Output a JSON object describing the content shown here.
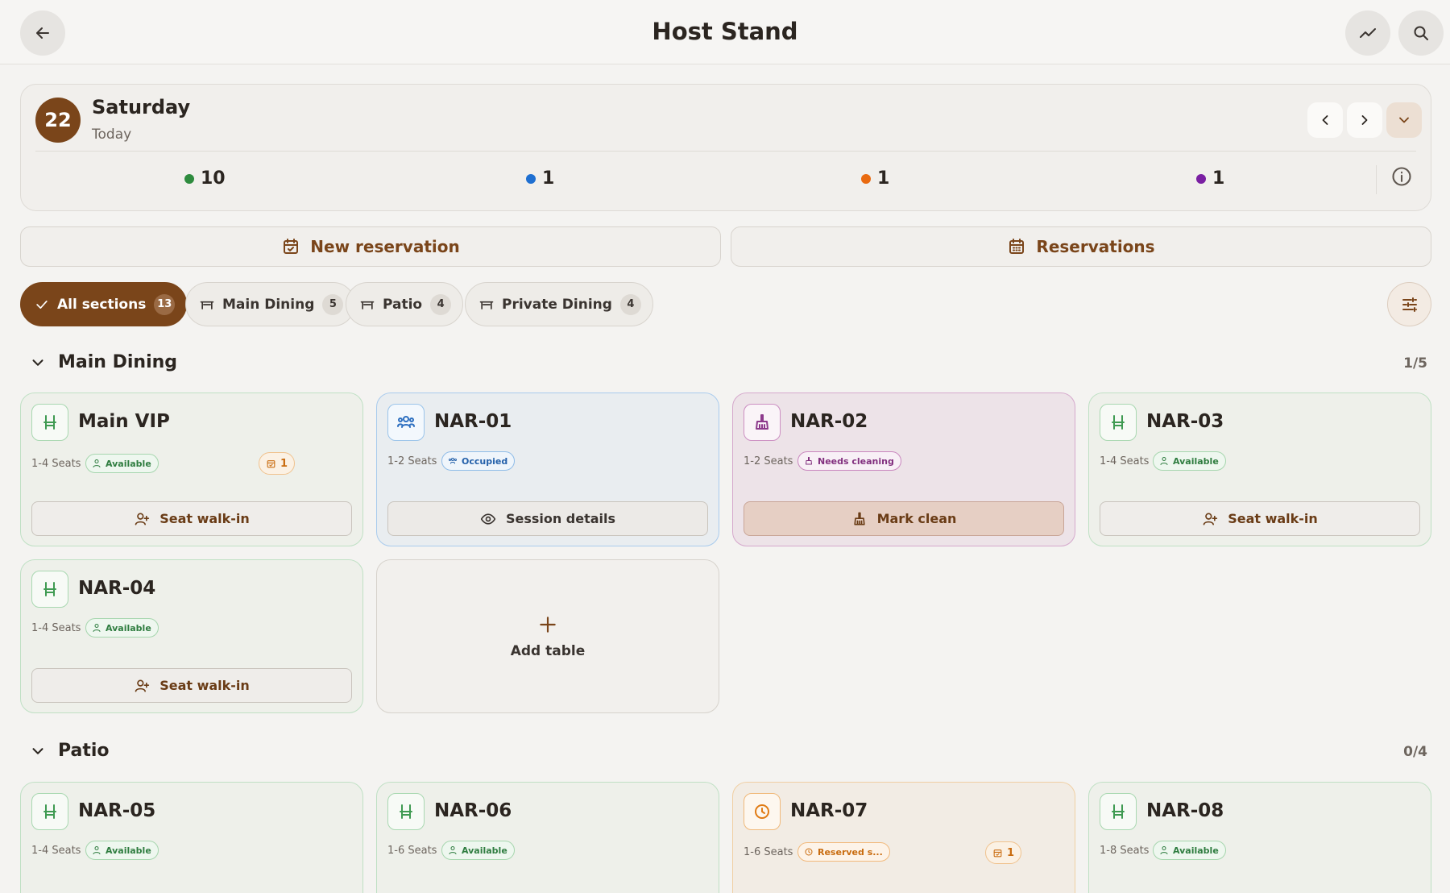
{
  "header": {
    "title": "Host Stand",
    "icons": [
      "back-arrow-icon",
      "trend-chart-icon",
      "search-icon"
    ]
  },
  "date": {
    "day_number": "22",
    "day_name": "Saturday",
    "subtitle": "Today"
  },
  "stats": [
    {
      "value": "10",
      "color": "#2e8b3e"
    },
    {
      "value": "1",
      "color": "#1f6fd1"
    },
    {
      "value": "1",
      "color": "#e96a10"
    },
    {
      "value": "1",
      "color": "#7a1fa2"
    }
  ],
  "actions": {
    "new_reservation": "New reservation",
    "reservations": "Reservations"
  },
  "chips": [
    {
      "label": "All sections",
      "count": "13",
      "active": true
    },
    {
      "label": "Main Dining",
      "count": "5"
    },
    {
      "label": "Patio",
      "count": "4"
    },
    {
      "label": "Private Dining",
      "count": "4"
    }
  ],
  "sections": [
    {
      "name": "Main Dining",
      "count": "1/5",
      "tables": [
        {
          "name": "Main VIP",
          "seats": "1-4 Seats",
          "status": "Available",
          "reservations": "1",
          "action": "Seat walk-in"
        },
        {
          "name": "NAR-01",
          "seats": "1-2 Seats",
          "status": "Occupied",
          "action": "Session details"
        },
        {
          "name": "NAR-02",
          "seats": "1-2 Seats",
          "status": "Needs cleaning",
          "action": "Mark clean"
        },
        {
          "name": "NAR-03",
          "seats": "1-4 Seats",
          "status": "Available",
          "action": "Seat walk-in"
        },
        {
          "name": "NAR-04",
          "seats": "1-4 Seats",
          "status": "Available",
          "action": "Seat walk-in"
        }
      ],
      "add_table": "Add table"
    },
    {
      "name": "Patio",
      "count": "0/4",
      "tables": [
        {
          "name": "NAR-05",
          "seats": "1-4 Seats",
          "status": "Available"
        },
        {
          "name": "NAR-06",
          "seats": "1-6 Seats",
          "status": "Available"
        },
        {
          "name": "NAR-07",
          "seats": "1-6 Seats",
          "status": "Reserved s...",
          "reservations": "1"
        },
        {
          "name": "NAR-08",
          "seats": "1-8 Seats",
          "status": "Available"
        }
      ]
    }
  ]
}
